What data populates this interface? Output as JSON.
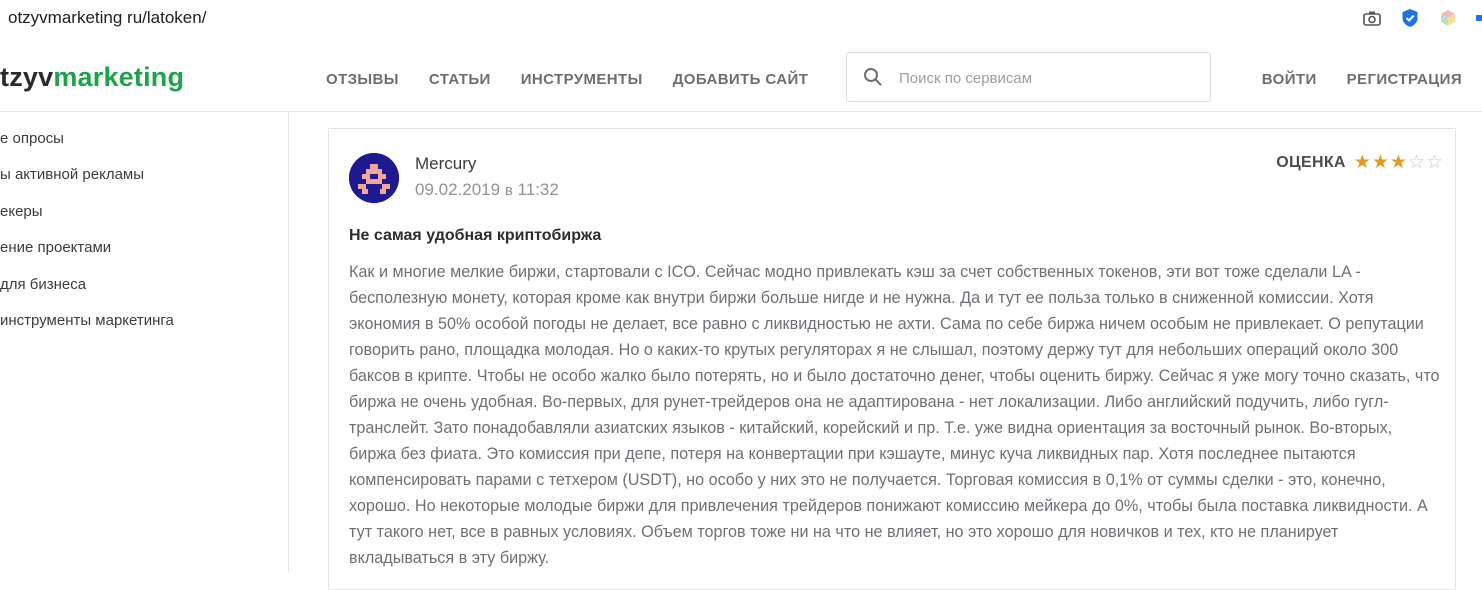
{
  "browser": {
    "url": "otzyvmarketing ru/latoken/",
    "icons": [
      "camera-icon",
      "shield-check-icon",
      "cube-extension-icon",
      "extension-icon"
    ]
  },
  "header": {
    "logo_part1": "tzyv",
    "logo_part2": "marketing",
    "nav": [
      "ОТЗЫВЫ",
      "СТАТЬИ",
      "ИНСТРУМЕНТЫ",
      "ДОБАВИТЬ САЙТ"
    ],
    "search_placeholder": "Поиск по сервисам",
    "login": "ВОЙТИ",
    "register": "РЕГИСТРАЦИЯ"
  },
  "sidebar": {
    "items": [
      "е опросы",
      "ы активной рекламы",
      "екеры",
      "ение проектами",
      "для бизнеса",
      "инструменты маркетинга"
    ]
  },
  "review": {
    "author": "Mercury",
    "date": "09.02.2019",
    "date_sep": "в",
    "time": "11:32",
    "rating_label": "ОЦЕНКА",
    "rating": 3,
    "rating_max": 5,
    "title": "Не самая удобная криптобиржа",
    "body": "Как и многие мелкие биржи, стартовали с ICO. Сейчас модно привлекать кэш за счет собственных токенов, эти вот тоже сделали LA - бесполезную монету, которая кроме как внутри биржи больше нигде и не нужна. Да и тут ее польза только в сниженной комиссии. Хотя экономия в 50% особой погоды не делает, все равно с ликвидностью не ахти. Сама по себе биржа ничем особым не привлекает. О репутации говорить рано, площадка молодая. Но о каких-то крутых регуляторах я не слышал, поэтому держу тут для небольших операций около 300 баксов в крипте. Чтобы не особо жалко было потерять, но и было достаточно денег, чтобы оценить биржу. Сейчас я уже могу точно сказать, что биржа не очень удобная. Во-первых, для рунет-трейдеров она не адаптирована - нет локализации. Либо английский подучить, либо гугл-транслейт. Зато понадобавляли азиатских языков - китайский, корейский и пр. Т.е. уже видна ориентация за восточный рынок. Во-вторых, биржа без фиата. Это комиссия при депе, потеря на конвертации при кэшауте, минус куча ликвидных пар. Хотя последнее пытаются компенсировать парами с тетхером (USDT), но особо у них это не получается. Торговая комиссия в 0,1% от суммы сделки - это, конечно, хорошо. Но некоторые молодые биржи для привлечения трейдеров понижают комиссию мейкера до 0%, чтобы была поставка ликвидности. А тут такого нет, все в равных условиях. Объем торгов тоже ни на что не влияет, но это хорошо для новичков и тех, кто не планирует вкладываться в эту биржу."
  },
  "colors": {
    "brand_green": "#1fa34a",
    "star": "#e59a1d",
    "avatar_bg": "#1e1a8f",
    "avatar_fg": "#f2a79c"
  }
}
